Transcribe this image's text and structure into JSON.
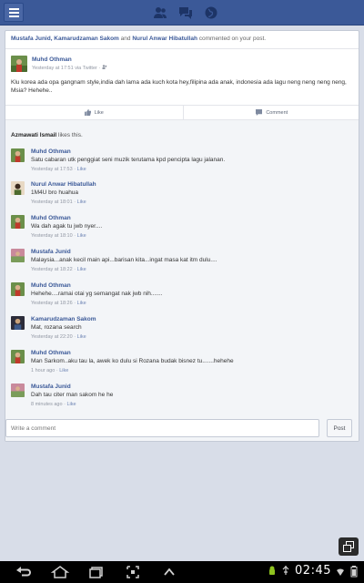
{
  "header": {
    "menu_icon": "hamburger-icon",
    "nav_icons": [
      "friend-requests-icon",
      "messages-icon",
      "notifications-globe-icon"
    ]
  },
  "notification": {
    "names": "Mustafa Junid, Kamarudzaman Sakom",
    "and": " and ",
    "last_name": "Nurul Anwar Hibatullah",
    "suffix": " commented on your post."
  },
  "post": {
    "author": "Muhd Othman",
    "meta": "Yesterday at 17:51 via Twitter · ",
    "text": "Klu korea ada opa gangnam style,india dah lama ada kuch kota hey,filipina ada anak, indonesia ada lagu neng neng neng neng, Msia? Hehehe..",
    "like_label": "Like",
    "comment_label": "Comment"
  },
  "likes": {
    "name": "Azmawati Ismail",
    "suffix": " likes this."
  },
  "comments": [
    {
      "name": "Muhd Othman",
      "text": "Satu cabaran utk penggiat seni muzik terutama kpd pencipta lagu jalanan.",
      "time": "Yesterday at 17:53 · ",
      "like": "Like"
    },
    {
      "name": "Nurul Anwar Hibatullah",
      "text": "1M4U bro huahua",
      "time": "Yesterday at 18:01 · ",
      "like": "Like"
    },
    {
      "name": "Muhd Othman",
      "text": "Wa dah agak tu jwb nyer....",
      "time": "Yesterday at 18:10 · ",
      "like": "Like"
    },
    {
      "name": "Mustafa Junid",
      "text": "Malaysia...anak kecil main api...barisan kita...ingat masa kat itm dulu....",
      "time": "Yesterday at 18:22 · ",
      "like": "Like"
    },
    {
      "name": "Muhd Othman",
      "text": "Hehehe....ramai otai yg semangat nak jwb nih.......",
      "time": "Yesterday at 18:26 · ",
      "like": "Like"
    },
    {
      "name": "Kamarudzaman Sakom",
      "text": "Mat, rozana search",
      "time": "Yesterday at 22:20 · ",
      "like": "Like"
    },
    {
      "name": "Muhd Othman",
      "text": "Man Sarkom..aku tau la, awek ko dulu si Rozana budak bisnez tu.......hehehe",
      "time": "1 hour ago · ",
      "like": "Like"
    },
    {
      "name": "Mustafa Junid",
      "text": "Dah tau citer man sakom he he",
      "time": "8 minutes ago · ",
      "like": "Like"
    }
  ],
  "composer": {
    "placeholder": "Write a comment",
    "post_label": "Post"
  },
  "system": {
    "time": "02:45",
    "nav_icons": [
      "back-icon",
      "home-icon",
      "recent-apps-icon",
      "screenshot-icon",
      "menu-up-icon"
    ],
    "status_icons": [
      "android-debug-icon",
      "usb-icon",
      "wifi-icon",
      "battery-icon"
    ]
  },
  "colors": {
    "brand": "#3b5998",
    "link": "#3b5998",
    "background": "#d8dde8"
  }
}
